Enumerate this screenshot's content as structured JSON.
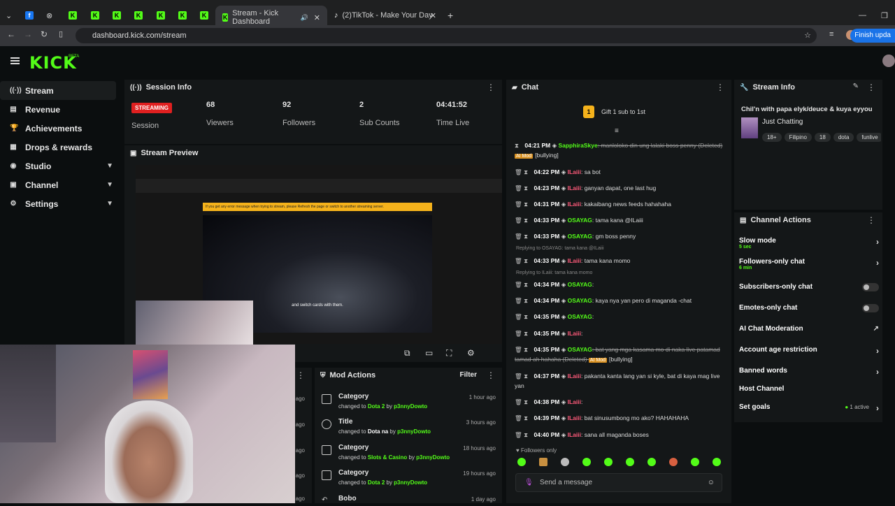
{
  "browser": {
    "active_tab": "Stream - Kick Dashboard",
    "other_tab": "(2)TikTok - Make Your Day",
    "url": "dashboard.kick.com/stream",
    "update_button": "Finish upda"
  },
  "brand": {
    "logo": "KICK",
    "beta": "BETA",
    "accent": "#53fc18"
  },
  "sidebar": {
    "items": [
      {
        "label": "Stream",
        "icon": "stream-icon"
      },
      {
        "label": "Revenue",
        "icon": "revenue-icon"
      },
      {
        "label": "Achievements",
        "icon": "trophy-icon"
      },
      {
        "label": "Drops & rewards",
        "icon": "gift-icon"
      },
      {
        "label": "Studio",
        "icon": "studio-icon"
      },
      {
        "label": "Channel",
        "icon": "channel-icon"
      },
      {
        "label": "Settings",
        "icon": "gear-icon"
      }
    ]
  },
  "session": {
    "title": "Session Info",
    "status": "STREAMING",
    "status_label": "Session",
    "viewers": "68",
    "viewers_label": "Viewers",
    "followers": "92",
    "followers_label": "Followers",
    "subs": "2",
    "subs_label": "Sub Counts",
    "time": "04:41:52",
    "time_label": "Time Live"
  },
  "preview": {
    "title": "Stream Preview",
    "caption": "and switch cards with them.",
    "warning": "If you get any error message when trying to stream, please Refresh the page or switch to another streaming server."
  },
  "mod_actions": {
    "title": "Mod Actions",
    "filter": "Filter",
    "rows": [
      {
        "title": "Category",
        "pre": "changed to ",
        "target": "Dota 2",
        "by": " by ",
        "user": "p3nnyDowto",
        "ago": "1 hour ago"
      },
      {
        "title": "Title",
        "pre": "changed to ",
        "target": "Dota na",
        "by": " by ",
        "user": "p3nnyDowto",
        "ago": "3 hours ago"
      },
      {
        "title": "Category",
        "pre": "changed to ",
        "target": "Slots & Casino",
        "by": " by ",
        "user": "p3nnyDowto",
        "ago": "18 hours ago"
      },
      {
        "title": "Category",
        "pre": "changed to ",
        "target": "Dota 2",
        "by": " by ",
        "user": "p3nnyDowto",
        "ago": "19 hours ago"
      },
      {
        "title": "Bobo",
        "pre": "",
        "target": "",
        "by": "",
        "user": "",
        "ago": "1 day ago"
      }
    ],
    "side_agos": [
      "ago",
      "ago",
      "ago",
      "ago",
      "ago"
    ]
  },
  "chat": {
    "title": "Chat",
    "gift": "Gift 1 sub to 1st",
    "gift_count": "1",
    "messages": [
      {
        "time": "04:21 PM",
        "user": "SapphiraSkye",
        "ucolor": "#53fc18",
        "text": ": manloloko din ung lalaki boss penny (Deleted) ",
        "aimod": "AI Mod",
        "tag": "[bullying]",
        "strike": true
      },
      {
        "time": "04:22 PM",
        "user": "ILaiii",
        "ucolor": "#ff5a7a",
        "text": ": sa bot"
      },
      {
        "time": "04:23 PM",
        "user": "ILaiii",
        "ucolor": "#ff5a7a",
        "text": ": ganyan dapat, one last hug"
      },
      {
        "time": "04:31 PM",
        "user": "ILaiii",
        "ucolor": "#ff5a7a",
        "text": ": kakaibang news feeds hahahaha"
      },
      {
        "time": "04:33 PM",
        "user": "OSAYAG",
        "ucolor": "#53fc18",
        "text": ": tama kana @ILaiii"
      },
      {
        "time": "04:33 PM",
        "user": "OSAYAG",
        "ucolor": "#53fc18",
        "text": ": gm boss penny"
      },
      {
        "time": "04:33 PM",
        "user": "ILaiii",
        "ucolor": "#ff5a7a",
        "text": ": tama kana momo"
      },
      {
        "time": "04:34 PM",
        "user": "OSAYAG",
        "ucolor": "#53fc18",
        "text": ":"
      },
      {
        "time": "04:34 PM",
        "user": "OSAYAG",
        "ucolor": "#53fc18",
        "text": ": kaya nya yan pero di maganda -chat"
      },
      {
        "time": "04:35 PM",
        "user": "OSAYAG",
        "ucolor": "#53fc18",
        "text": ":"
      },
      {
        "time": "04:35 PM",
        "user": "ILaiii",
        "ucolor": "#ff5a7a",
        "text": ":"
      },
      {
        "time": "04:35 PM",
        "user": "OSAYAG",
        "ucolor": "#53fc18",
        "text": ": bat yang mga kasama mo di naka live patamad tamad ah hahaha (Deleted) ",
        "aimod": "AI Mod",
        "tag": "[bullying]",
        "strike": true
      },
      {
        "time": "04:37 PM",
        "user": "ILaiii",
        "ucolor": "#ff5a7a",
        "text": ": pakanta kanta lang yan si kyle, bat di kaya mag live yan"
      },
      {
        "time": "04:38 PM",
        "user": "ILaiii",
        "ucolor": "#ff5a7a",
        "text": ":"
      },
      {
        "time": "04:39 PM",
        "user": "ILaiii",
        "ucolor": "#ff5a7a",
        "text": ": bat sinusumbong mo ako? HAHAHAHA"
      },
      {
        "time": "04:40 PM",
        "user": "ILaiii",
        "ucolor": "#ff5a7a",
        "text": ": sana all maganda boses"
      }
    ],
    "reply1": "Replying to OSAYAG: tama kana @ILaiii",
    "reply2": "Replying to ILaiii: tama kana momo",
    "followers_only": "Followers only",
    "placeholder": "Send a message"
  },
  "stream_info": {
    "title": "Stream Info",
    "stream_title": "Chil'n with papa elyk/deuce & kuya eyyou",
    "category": "Just Chatting",
    "tags": [
      "18+",
      "Filipino",
      "18",
      "dota",
      "funlive"
    ]
  },
  "channel_actions": {
    "title": "Channel Actions",
    "rows": [
      {
        "label": "Slow mode",
        "sub": "5 sec",
        "kind": "arrow"
      },
      {
        "label": "Followers-only chat",
        "sub": "6 min",
        "kind": "arrow"
      },
      {
        "label": "Subscribers-only chat",
        "sub": "",
        "kind": "toggle"
      },
      {
        "label": "Emotes-only chat",
        "sub": "",
        "kind": "toggle"
      },
      {
        "label": "AI Chat Moderation",
        "sub": "",
        "kind": "external"
      },
      {
        "label": "Account age restriction",
        "sub": "",
        "kind": "arrow"
      },
      {
        "label": "Banned words",
        "sub": "",
        "kind": "arrow"
      },
      {
        "label": "Host Channel",
        "sub": "",
        "kind": "none"
      },
      {
        "label": "Set goals",
        "sub": "",
        "kind": "goals",
        "active": "1 active"
      }
    ]
  }
}
